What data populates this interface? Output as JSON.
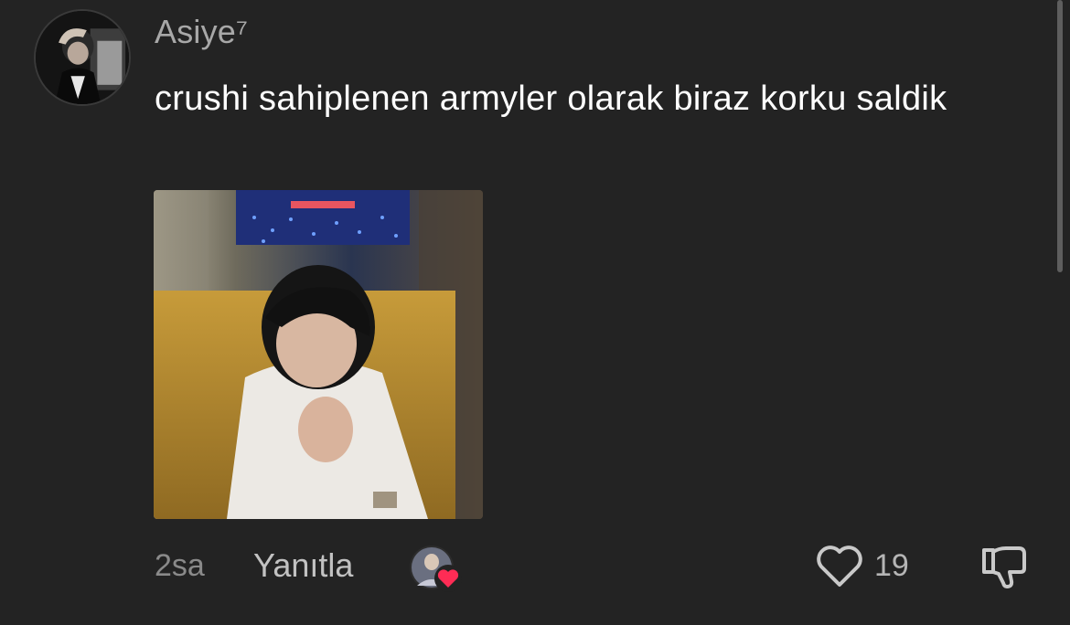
{
  "comment": {
    "username": "Asiye⁷",
    "text": "crushi sahiplenen armyler olarak biraz korku saldik",
    "timestamp": "2sa",
    "reply_label": "Yanıtla",
    "like_count": "19",
    "liked_by_creator": true
  },
  "icons": {
    "avatar": "profile-avatar",
    "photo": "attached-photo",
    "creator_like": "creator-heart-badge-icon",
    "like": "heart-outline-icon",
    "dislike": "thumbs-down-icon"
  },
  "colors": {
    "background": "#232323",
    "username": "#a8a8a8",
    "text": "#ffffff",
    "muted": "#8a8a8a",
    "heart_badge": "#fe2c55"
  }
}
